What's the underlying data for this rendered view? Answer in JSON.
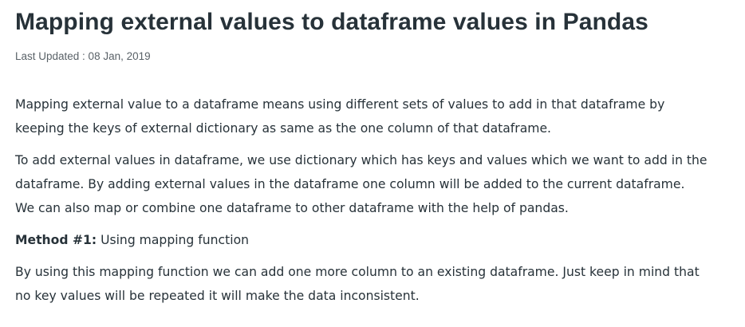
{
  "article": {
    "title": "Mapping external values to dataframe values in Pandas",
    "last_updated": "Last Updated : 08 Jan, 2019",
    "paragraphs": [
      {
        "lines": [
          "Mapping external value to a dataframe means using different sets of values to add in that dataframe by",
          "keeping the keys of external dictionary as same as the one column of that dataframe."
        ]
      },
      {
        "lines": [
          "To add external values in dataframe, we use dictionary which has keys and values which we want to add in the",
          "dataframe. By adding external values in the dataframe one column will be added to the current dataframe.",
          "We can also map or combine one dataframe to other dataframe with the help of pandas."
        ]
      },
      {
        "method_label": "Method #1:",
        "method_text": " Using mapping function"
      },
      {
        "lines": [
          "By using this mapping function we can add one more column to an existing dataframe. Just keep in mind that",
          "no key values will be repeated it will make the data inconsistent."
        ]
      }
    ]
  }
}
